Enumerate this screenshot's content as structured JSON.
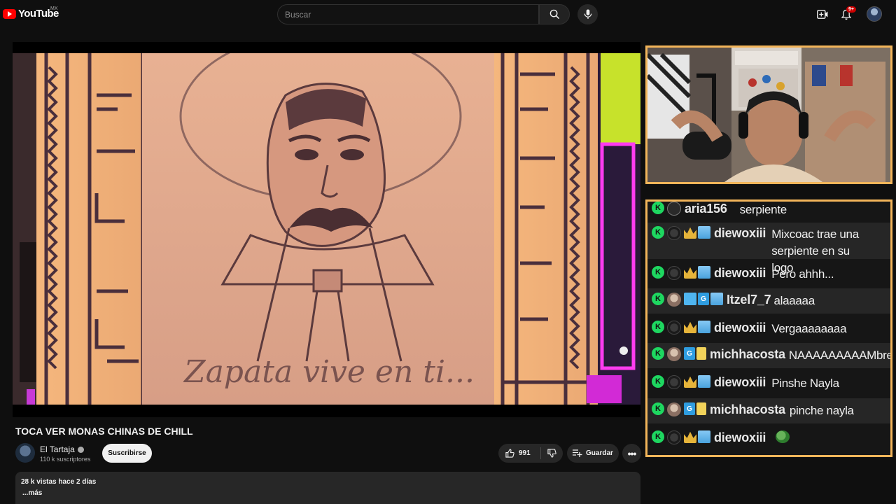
{
  "header": {
    "logo_text": "YouTube",
    "region": "MX",
    "search_placeholder": "Buscar",
    "notification_count": "9+"
  },
  "video": {
    "overlay_text": "Zapata vive en ti...",
    "title": "TOCA VER MONAS CHINAS DE CHILL"
  },
  "channel": {
    "name": "El Tartaja",
    "subscribers": "110 k suscriptores",
    "subscribe_label": "Suscribirse"
  },
  "actions": {
    "likes": "991",
    "save_label": "Guardar",
    "more_label": "•••"
  },
  "description": {
    "meta": "28 k vistas  hace 2 días",
    "more": "...más"
  },
  "chat": {
    "messages": [
      {
        "user": "aria156",
        "text": "serpiente",
        "avatar": "grey",
        "badges": []
      },
      {
        "user": "diewoxiii",
        "text": "Mixcoac trae una serpiente en su logo",
        "avatar": "dark",
        "badges": [
          "crown",
          "sub"
        ]
      },
      {
        "user": "diewoxiii",
        "text": "Pero ahhh...",
        "avatar": "dark",
        "badges": [
          "crown",
          "sub"
        ]
      },
      {
        "user": "Itzel7_7",
        "text": "alaaaaa",
        "avatar": "light",
        "badges": [
          "tool",
          "gg",
          "sub"
        ]
      },
      {
        "user": "diewoxiii",
        "text": "Vergaaaaaaaa",
        "avatar": "dark",
        "badges": [
          "crown",
          "sub"
        ]
      },
      {
        "user": "michhacosta",
        "text": "NAAAAAAAAAMbre",
        "avatar": "light",
        "badges": [
          "gg",
          "gift"
        ]
      },
      {
        "user": "diewoxiii",
        "text": "Pinshe Nayla",
        "avatar": "dark",
        "badges": [
          "crown",
          "sub"
        ]
      },
      {
        "user": "michhacosta",
        "text": "pinche nayla",
        "avatar": "light",
        "badges": [
          "gg",
          "gift"
        ]
      },
      {
        "user": "diewoxiii",
        "text": "",
        "avatar": "dark",
        "badges": [
          "crown",
          "sub"
        ],
        "emote": "pepe-emote"
      }
    ]
  },
  "colors": {
    "accent_red": "#ff0000",
    "overlay_border": "#f2b55a",
    "kick_green": "#1ed760"
  }
}
